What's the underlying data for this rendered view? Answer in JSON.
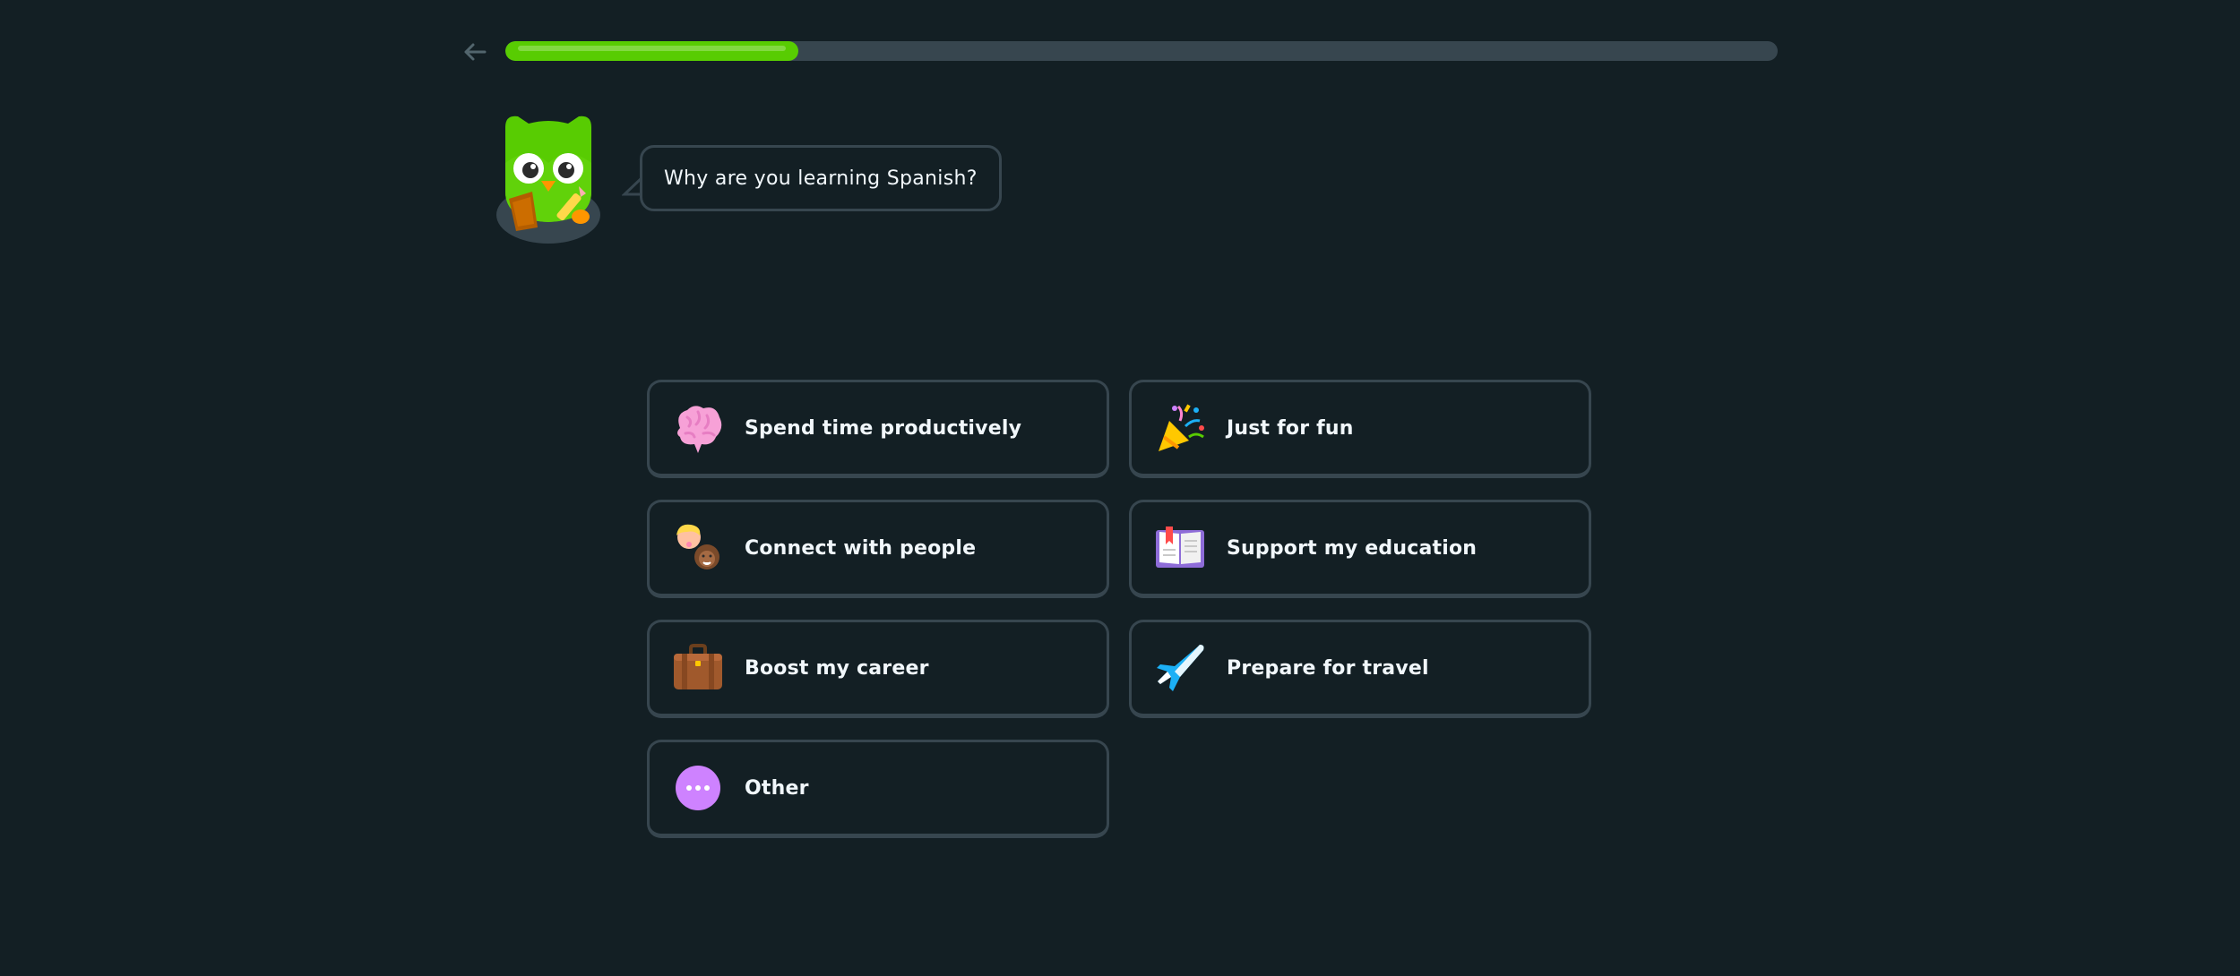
{
  "progress": {
    "value": 0.23
  },
  "prompt": {
    "question": "Why are you learning Spanish?"
  },
  "colors": {
    "background": "#131f24",
    "accent_green": "#58cc02",
    "border": "#37464f",
    "text": "#f1f7fb"
  },
  "options": [
    {
      "label": "Spend time productively",
      "icon": "brain-icon"
    },
    {
      "label": "Just for fun",
      "icon": "party-popper-icon"
    },
    {
      "label": "Connect with people",
      "icon": "people-icon"
    },
    {
      "label": "Support my education",
      "icon": "open-book-icon"
    },
    {
      "label": "Boost my career",
      "icon": "briefcase-icon"
    },
    {
      "label": "Prepare for travel",
      "icon": "airplane-icon"
    },
    {
      "label": "Other",
      "icon": "more-dots-icon"
    }
  ]
}
